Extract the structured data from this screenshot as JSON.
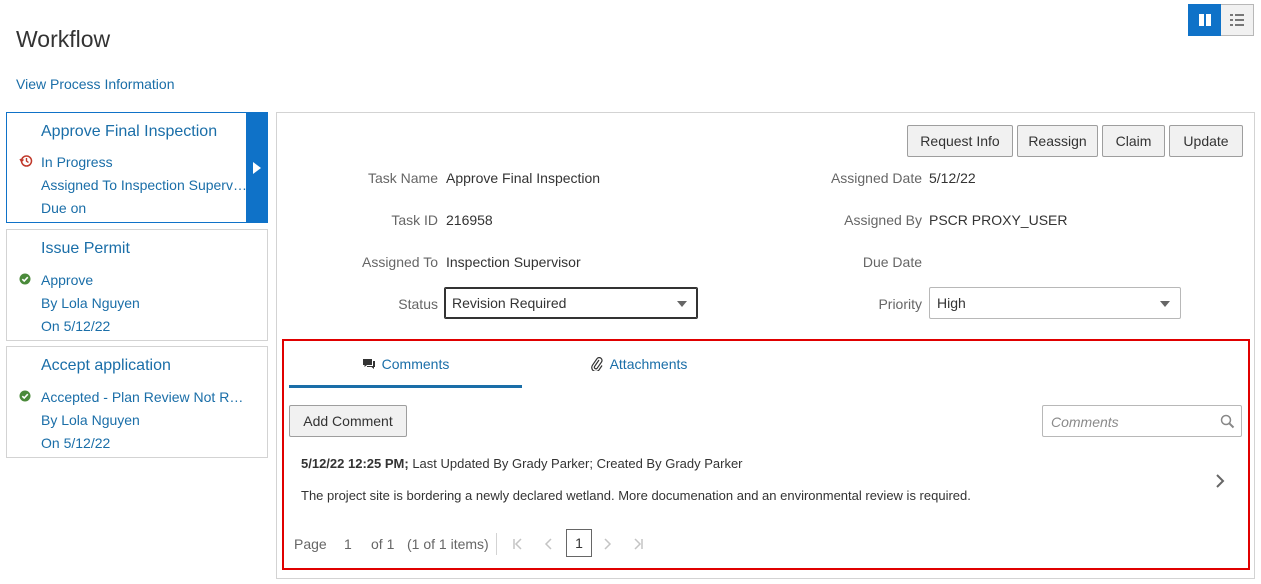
{
  "page": {
    "title": "Workflow",
    "process_link": "View Process Information"
  },
  "view_toggle": {
    "options": [
      "split-view-icon",
      "list-view-icon"
    ],
    "selected": "split-view-icon"
  },
  "tasks": [
    {
      "title": "Approve Final Inspection",
      "status_icon": "history-icon",
      "status": "In Progress",
      "line2": "Assigned To Inspection Supervisor",
      "line3": "Due on",
      "selected": true
    },
    {
      "title": "Issue Permit",
      "status_icon": "check-circle-icon",
      "status": "Approve",
      "line2": "By Lola Nguyen",
      "line3": "On 5/12/22",
      "selected": false
    },
    {
      "title": "Accept application",
      "status_icon": "check-circle-icon",
      "status": "Accepted - Plan Review Not Required",
      "line2": "By Lola Nguyen",
      "line3": "On 5/12/22",
      "selected": false
    }
  ],
  "actions": {
    "request_info": "Request Info",
    "reassign": "Reassign",
    "claim": "Claim",
    "update": "Update"
  },
  "details": {
    "task_name_label": "Task Name",
    "task_name": "Approve Final Inspection",
    "task_id_label": "Task ID",
    "task_id": "216958",
    "assigned_to_label": "Assigned To",
    "assigned_to": "Inspection Supervisor",
    "status_label": "Status",
    "status": "Revision Required",
    "assigned_date_label": "Assigned Date",
    "assigned_date": "5/12/22",
    "assigned_by_label": "Assigned By",
    "assigned_by": "PSCR PROXY_USER",
    "due_date_label": "Due Date",
    "due_date": "",
    "priority_label": "Priority",
    "priority": "High"
  },
  "comments_section": {
    "tabs": [
      {
        "label": "Comments",
        "icon": "comments-icon",
        "active": true
      },
      {
        "label": "Attachments",
        "icon": "paperclip-icon",
        "active": false
      }
    ],
    "add_button": "Add Comment",
    "search_placeholder": "Comments",
    "comments": [
      {
        "timestamp": "5/12/22 12:25 PM;",
        "meta": "Last Updated By Grady Parker; Created By Grady Parker",
        "body": "The project site is bordering a newly declared wetland. More documenation and an environmental review is required."
      }
    ],
    "pager": {
      "page_label": "Page",
      "current_page": "1",
      "of_pages": "of 1",
      "items_summary": "(1 of 1 items)",
      "page_button": "1"
    }
  },
  "colors": {
    "accent": "#0f72c8",
    "link": "#1a6ea8",
    "highlight": "#e00000",
    "success": "#4a8a3a",
    "in_progress": "#c0392b"
  }
}
